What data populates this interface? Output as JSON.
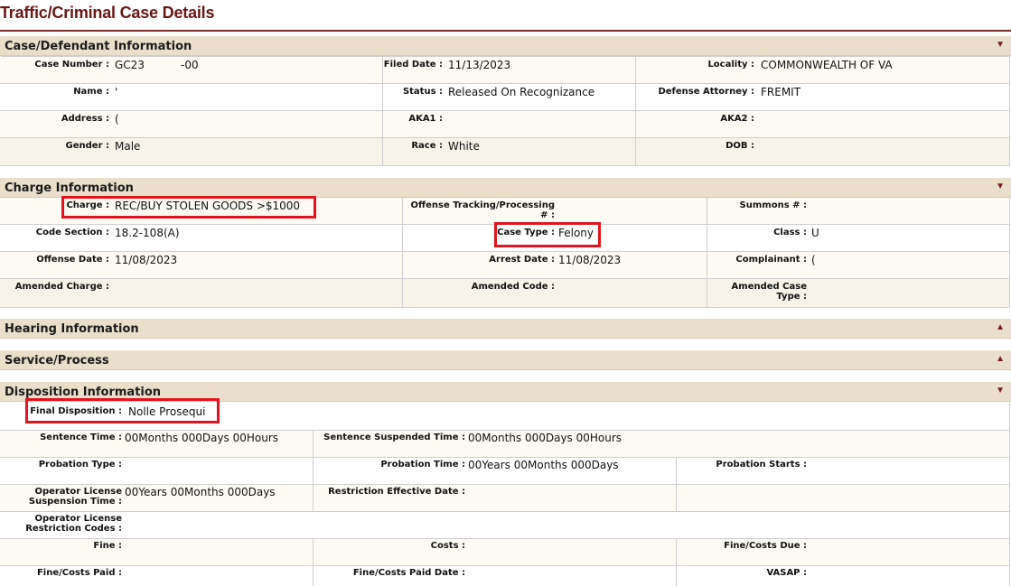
{
  "page": {
    "title": "Traffic/Criminal Case Details"
  },
  "colors": {
    "title": "#6b1616",
    "section_bg": "#e9dfcb",
    "highlight": "#e3141b"
  },
  "case_section": {
    "title": "Case/Defendant Information",
    "case_number_label": "Case Number :",
    "case_number_a": "GC23",
    "case_number_b": "-00",
    "filed_date_label": "Filed Date :",
    "filed_date": "11/13/2023",
    "locality_label": "Locality :",
    "locality": "COMMONWEALTH OF VA",
    "name_label": "Name :",
    "name_value": "'",
    "status_label": "Status :",
    "status": "Released On Recognizance",
    "defense_label": "Defense Attorney :",
    "defense": "FREMIT",
    "address_label": "Address :",
    "address_value": "(",
    "aka1_label": "AKA1 :",
    "aka2_label": "AKA2 :",
    "gender_label": "Gender :",
    "gender": "Male",
    "race_label": "Race :",
    "race": "White",
    "dob_label": "DOB :"
  },
  "charge_section": {
    "title": "Charge Information",
    "charge_label": "Charge :",
    "charge": "REC/BUY STOLEN GOODS >$1000",
    "otp_label_1": "Offense Tracking/Processing",
    "otp_label_2": "# :",
    "summons_label": "Summons # :",
    "code_label": "Code Section :",
    "code": "18.2-108(A)",
    "case_type_label": "Case Type :",
    "case_type": "Felony",
    "class_label": "Class :",
    "class_value": "U",
    "offense_date_label": "Offense Date :",
    "offense_date": "11/08/2023",
    "arrest_date_label": "Arrest Date :",
    "arrest_date": "11/08/2023",
    "complainant_label": "Complainant :",
    "complainant": "(",
    "amended_charge_label": "Amended Charge :",
    "amended_code_label": "Amended Code :",
    "amended_type_label_1": "Amended Case",
    "amended_type_label_2": "Type :"
  },
  "hearing_section": {
    "title": "Hearing Information"
  },
  "service_section": {
    "title": "Service/Process"
  },
  "disposition_section": {
    "title": "Disposition Information",
    "final_label": "Final Disposition :",
    "final": "Nolle Prosequi",
    "sentence_time_label": "Sentence Time :",
    "sentence_time": "00Months 000Days 00Hours",
    "sentence_susp_label": "Sentence Suspended Time :",
    "sentence_susp": "00Months 000Days 00Hours",
    "probation_type_label": "Probation Type :",
    "probation_time_label": "Probation Time :",
    "probation_time": "00Years 00Months 000Days",
    "probation_starts_label": "Probation Starts :",
    "ol_susp_label_1": "Operator License",
    "ol_susp_label_2": "Suspension Time :",
    "ol_susp": "00Years 00Months 000Days",
    "restriction_label": "Restriction Effective Date :",
    "ol_restr_label_1": "Operator License",
    "ol_restr_label_2": "Restriction Codes :",
    "fine_label": "Fine :",
    "costs_label": "Costs :",
    "fine_due_label": "Fine/Costs Due :",
    "fine_paid_label": "Fine/Costs Paid :",
    "fine_paid_date_label": "Fine/Costs Paid Date :",
    "vasap_label": "VASAP :"
  }
}
